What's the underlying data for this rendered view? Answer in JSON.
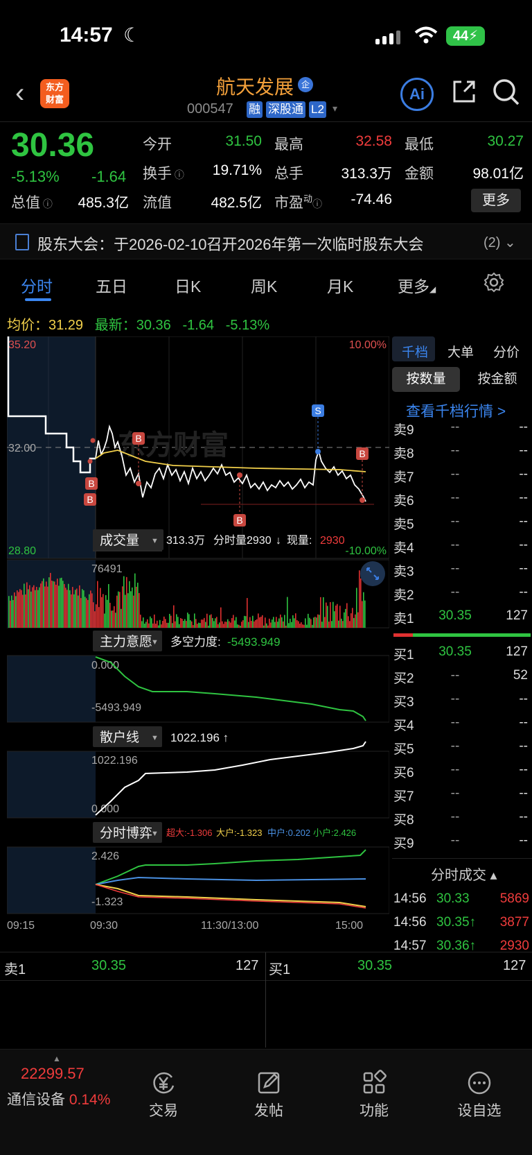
{
  "status_bar": {
    "time": "14:57",
    "battery": "44"
  },
  "header": {
    "logo_text": "东方\n财富",
    "stock_name": "航天发展",
    "badge": "企",
    "code": "000547",
    "tags": [
      "融",
      "深股通",
      "L2"
    ],
    "ai_label": "Ai"
  },
  "quote": {
    "price": "30.36",
    "pct_change": "-5.13%",
    "change": "-1.64",
    "open_label": "今开",
    "open": "31.50",
    "high_label": "最高",
    "high": "32.58",
    "low_label": "最低",
    "low": "30.27",
    "turnover_label": "换手",
    "turnover": "19.71%",
    "volume_label": "总手",
    "volume": "313.3万",
    "amount_label": "金额",
    "amount": "98.01亿",
    "mcap_label": "总值",
    "mcap": "485.3亿",
    "float_label": "流值",
    "float": "482.5亿",
    "pe_label": "市盈",
    "pe_sup": "动",
    "pe": "-74.46",
    "more_label": "更多"
  },
  "notice": {
    "text": "股东大会：于2026-02-10召开2026年第一次临时股东大会",
    "count": "(2)"
  },
  "tabs": [
    "分时",
    "五日",
    "日K",
    "周K",
    "月K",
    "更多"
  ],
  "avg_line": {
    "avg_label": "均价：",
    "avg": "31.29",
    "last_label": "最新：",
    "last": "30.36",
    "chg": "-1.64",
    "pct": "-5.13%"
  },
  "chart_data": {
    "type": "line",
    "price_axis": {
      "top": "35.20",
      "mid": "32.00",
      "bottom": "28.80",
      "top_pct": "10.00%",
      "bottom_pct": "-10.00%"
    },
    "x_labels": [
      "09:15",
      "09:30",
      "11:30/13:00",
      "15:00"
    ],
    "markers": [
      "B",
      "B",
      "B",
      "B",
      "B",
      "S",
      "B"
    ],
    "volume_panel": {
      "label": "成交量",
      "info_total": "313.3万",
      "info_bar_label": "分时量:",
      "info_bar": "2930",
      "info_arrow": "↓",
      "info_now_label": "现量:",
      "info_now": "2930",
      "max": "76491"
    },
    "main_force_panel": {
      "label": "主力意愿",
      "info_label": "多空力度:",
      "info": "-5493.949",
      "top": "0.000",
      "bottom": "-5493.949"
    },
    "retail_panel": {
      "label": "散户线",
      "info": "1022.196 ↑",
      "top": "1022.196",
      "bottom": "0.000"
    },
    "game_panel": {
      "label": "分时博弈",
      "super": "超大:-1.306",
      "large": "大户:-1.323",
      "mid": "中户:0.202",
      "small": "小户:2.426",
      "top": "2.426",
      "bottom": "-1.323"
    }
  },
  "order_book": {
    "tabs": [
      "千档",
      "大单",
      "分价"
    ],
    "seg": [
      "按数量",
      "按金额"
    ],
    "link": "查看千档行情 >",
    "asks": [
      {
        "label": "卖9",
        "price": "--",
        "vol": "--"
      },
      {
        "label": "卖8",
        "price": "--",
        "vol": "--"
      },
      {
        "label": "卖7",
        "price": "--",
        "vol": "--"
      },
      {
        "label": "卖6",
        "price": "--",
        "vol": "--"
      },
      {
        "label": "卖5",
        "price": "--",
        "vol": "--"
      },
      {
        "label": "卖4",
        "price": "--",
        "vol": "--"
      },
      {
        "label": "卖3",
        "price": "--",
        "vol": "--"
      },
      {
        "label": "卖2",
        "price": "--",
        "vol": "--"
      },
      {
        "label": "卖1",
        "price": "30.35",
        "vol": "127"
      }
    ],
    "bids": [
      {
        "label": "买1",
        "price": "30.35",
        "vol": "127"
      },
      {
        "label": "买2",
        "price": "--",
        "vol": "52"
      },
      {
        "label": "买3",
        "price": "--",
        "vol": "--"
      },
      {
        "label": "买4",
        "price": "--",
        "vol": "--"
      },
      {
        "label": "买5",
        "price": "--",
        "vol": "--"
      },
      {
        "label": "买6",
        "price": "--",
        "vol": "--"
      },
      {
        "label": "买7",
        "price": "--",
        "vol": "--"
      },
      {
        "label": "买8",
        "price": "--",
        "vol": "--"
      },
      {
        "label": "买9",
        "price": "--",
        "vol": "--"
      }
    ],
    "trades_title": "分时成交 ▴",
    "trades": [
      {
        "time": "14:56",
        "price": "30.33",
        "vol": "5869"
      },
      {
        "time": "14:56",
        "price": "30.35↑",
        "vol": "3877"
      },
      {
        "time": "14:57",
        "price": "30.36↑",
        "vol": "2930"
      }
    ]
  },
  "bottom_quote": {
    "ask_label": "卖1",
    "ask_price": "30.35",
    "ask_vol": "127",
    "bid_label": "买1",
    "bid_price": "30.35",
    "bid_vol": "127"
  },
  "bottom_nav": {
    "index_value": "22299.57",
    "sector": "通信设备",
    "sector_pct": "0.14%",
    "items": [
      "交易",
      "发帖",
      "功能",
      "设自选"
    ]
  },
  "colors": {
    "up": "#f03c3c",
    "down": "#2fc441",
    "accent": "#3b86f0",
    "avg": "#f2d04b"
  }
}
